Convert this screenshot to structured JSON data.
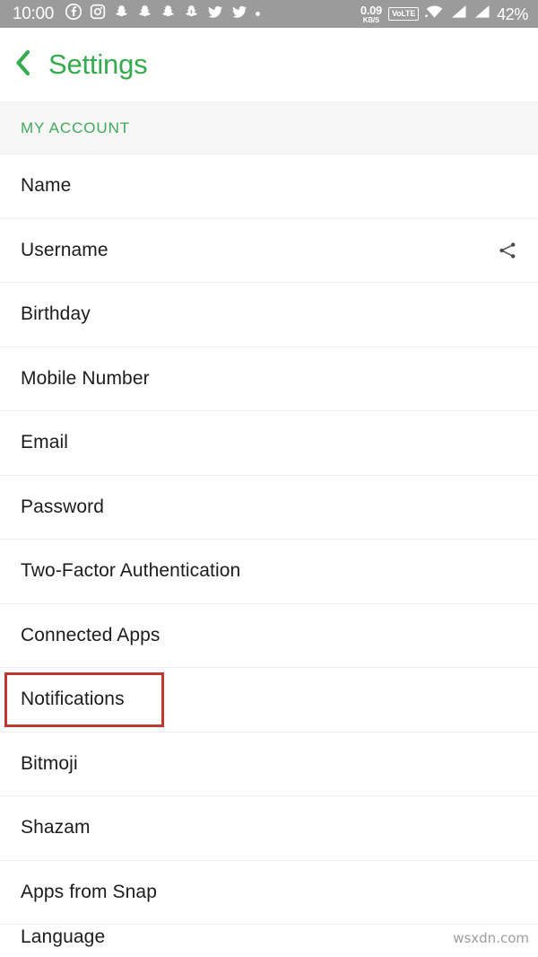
{
  "status_bar": {
    "clock": "10:00",
    "network_speed_value": "0.09",
    "network_speed_unit": "KB/S",
    "volte_label": "VoLTE",
    "battery": "42%",
    "left_icons": [
      "facebook-icon",
      "instagram-icon",
      "snapchat-ghost-icon",
      "snapchat-ghost-icon",
      "snapchat-ghost-icon",
      "snapchat-bolt-icon",
      "twitter-bird-icon",
      "twitter-bird-icon",
      "more-dot-icon"
    ],
    "right_icons": [
      "wifi-icon",
      "signal-bars-icon",
      "signal-bars-icon"
    ]
  },
  "header": {
    "back_icon": "chevron-left-icon",
    "title": "Settings",
    "accent_color": "#36ab4e"
  },
  "section": {
    "label": "MY ACCOUNT",
    "label_color": "#3faa5a",
    "background": "#f6f6f6"
  },
  "list": {
    "rows": [
      {
        "label": "Name",
        "accessory": null
      },
      {
        "label": "Username",
        "accessory": "share-icon"
      },
      {
        "label": "Birthday",
        "accessory": null
      },
      {
        "label": "Mobile Number",
        "accessory": null
      },
      {
        "label": "Email",
        "accessory": null
      },
      {
        "label": "Password",
        "accessory": null
      },
      {
        "label": "Two-Factor Authentication",
        "accessory": null
      },
      {
        "label": "Connected Apps",
        "accessory": null
      },
      {
        "label": "Notifications",
        "accessory": null,
        "highlighted": true
      },
      {
        "label": "Bitmoji",
        "accessory": null
      },
      {
        "label": "Shazam",
        "accessory": null
      },
      {
        "label": "Apps from Snap",
        "accessory": null
      },
      {
        "label": "Language",
        "accessory": null,
        "clipped": true
      }
    ]
  },
  "annotation": {
    "highlight_color": "#c0392f",
    "highlight_target": "Notifications"
  },
  "watermark": {
    "text": "wsxdn.com"
  }
}
